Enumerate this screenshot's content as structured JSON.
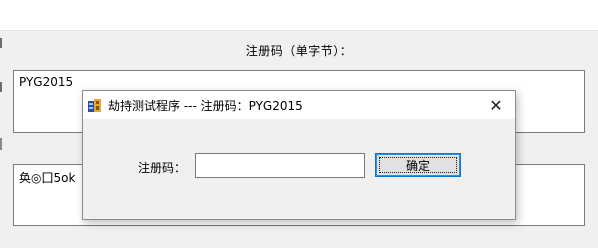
{
  "parent_window": {
    "label": "注册码（单字节）：",
    "box1_text": "PYG2015",
    "box2_text": "奂◎囗5ok"
  },
  "dialog": {
    "title": "劫持测试程序 --- 注册码：PYG2015",
    "icon": "app-icon",
    "close_glyph": "✕",
    "field_label": "注册码：",
    "input_value": "",
    "ok_label": "确定"
  },
  "colors": {
    "window_bg": "#f0f0f0",
    "titlebar_bg": "#ffffff",
    "focus_border": "#0078d7"
  }
}
